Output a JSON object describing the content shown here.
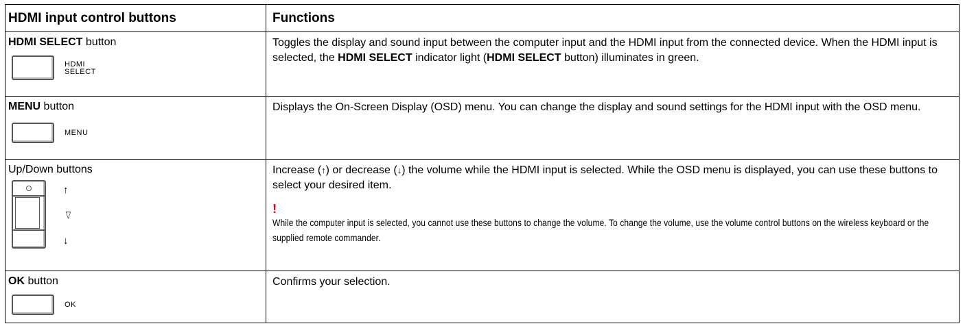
{
  "table": {
    "headers": [
      "HDMI input control buttons",
      "Functions"
    ],
    "rows": [
      {
        "label_bold": "HDMI SELECT",
        "label_rest": " button",
        "key_text_line1": "HDMI",
        "key_text_line2": "SELECT",
        "desc_1": "Toggles the display and sound input between the computer input and the HDMI input from the connected device. When the HDMI input is selected, the ",
        "desc_bold_1": "HDMI SELECT",
        "desc_2": " indicator light (",
        "desc_bold_2": "HDMI SELECT",
        "desc_3": " button) illuminates in green."
      },
      {
        "label_bold": "MENU",
        "label_rest": " button",
        "key_text": "MENU",
        "desc": "Displays the On-Screen Display (OSD) menu. You can change the display and sound settings for the HDMI input with the OSD menu."
      },
      {
        "label": "Up/Down buttons",
        "up_glyph": "↑",
        "mid_glyph": "▽",
        "down_glyph": "↓",
        "desc_1": "Increase (",
        "up_inline": "↑",
        "desc_2": ") or decrease (",
        "down_inline": "↓",
        "desc_3": ") the volume while the HDMI input is selected. While the OSD menu is displayed, you can use these buttons to select your desired item.",
        "note_mark": "!",
        "note": "While the computer input is selected, you cannot use these buttons to change the volume. To change the volume, use the volume control buttons on the wireless keyboard or the supplied remote commander."
      },
      {
        "label_bold": "OK",
        "label_rest": " button",
        "key_text": "OK",
        "desc": "Confirms your selection."
      }
    ]
  },
  "colors": {
    "note_mark": "#e8001c"
  }
}
